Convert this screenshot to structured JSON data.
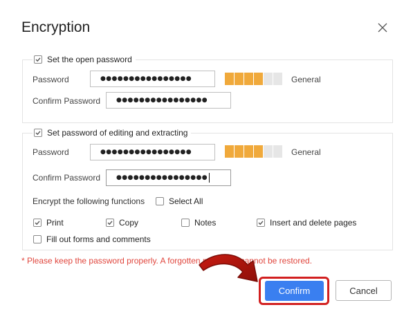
{
  "dialog": {
    "title": "Encryption",
    "close_icon": "close-icon"
  },
  "open_password": {
    "checkbox_label": "Set the open password",
    "checked": true,
    "password_label": "Password",
    "password_value": "●●●●●●●●●●●●●●●●",
    "confirm_label": "Confirm Password",
    "confirm_value": "●●●●●●●●●●●●●●●●",
    "strength_filled": 4,
    "strength_total": 6,
    "strength_text": "General"
  },
  "edit_password": {
    "checkbox_label": "Set password of editing and extracting",
    "checked": true,
    "password_label": "Password",
    "password_value": "●●●●●●●●●●●●●●●●",
    "confirm_label": "Confirm Password",
    "confirm_value": "●●●●●●●●●●●●●●●●",
    "strength_filled": 4,
    "strength_total": 6,
    "strength_text": "General",
    "encrypt_functions_label": "Encrypt the following functions",
    "select_all": {
      "label": "Select All",
      "checked": false
    },
    "options": [
      {
        "label": "Print",
        "checked": true
      },
      {
        "label": "Copy",
        "checked": true
      },
      {
        "label": "Notes",
        "checked": false
      },
      {
        "label": "Insert and delete pages",
        "checked": true
      },
      {
        "label": "Fill out forms and comments",
        "checked": false
      }
    ]
  },
  "warning": "*  Please keep the password properly. A forgotten password cannot be restored.",
  "buttons": {
    "confirm": "Confirm",
    "cancel": "Cancel"
  },
  "colors": {
    "accent": "#3a7ff0",
    "strength_on": "#f0a93b",
    "strength_off": "#e6e6e6",
    "warning": "#e0453c",
    "highlight": "#d21f1f"
  }
}
